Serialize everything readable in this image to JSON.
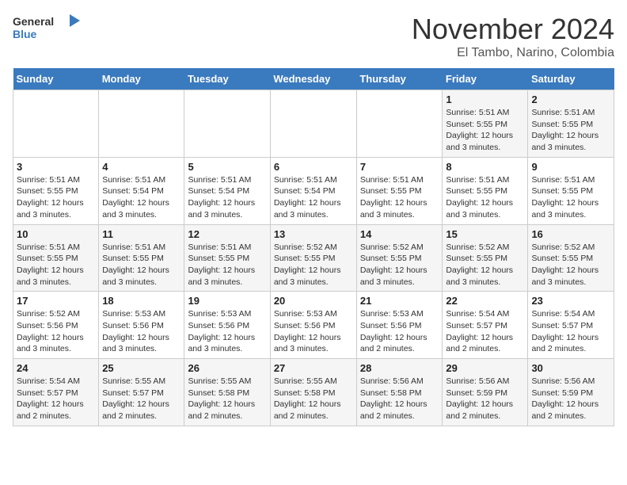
{
  "header": {
    "logo_general": "General",
    "logo_blue": "Blue",
    "month_title": "November 2024",
    "subtitle": "El Tambo, Narino, Colombia"
  },
  "days_of_week": [
    "Sunday",
    "Monday",
    "Tuesday",
    "Wednesday",
    "Thursday",
    "Friday",
    "Saturday"
  ],
  "weeks": [
    [
      {
        "day": "",
        "info": ""
      },
      {
        "day": "",
        "info": ""
      },
      {
        "day": "",
        "info": ""
      },
      {
        "day": "",
        "info": ""
      },
      {
        "day": "",
        "info": ""
      },
      {
        "day": "1",
        "info": "Sunrise: 5:51 AM\nSunset: 5:55 PM\nDaylight: 12 hours\nand 3 minutes."
      },
      {
        "day": "2",
        "info": "Sunrise: 5:51 AM\nSunset: 5:55 PM\nDaylight: 12 hours\nand 3 minutes."
      }
    ],
    [
      {
        "day": "3",
        "info": "Sunrise: 5:51 AM\nSunset: 5:55 PM\nDaylight: 12 hours\nand 3 minutes."
      },
      {
        "day": "4",
        "info": "Sunrise: 5:51 AM\nSunset: 5:54 PM\nDaylight: 12 hours\nand 3 minutes."
      },
      {
        "day": "5",
        "info": "Sunrise: 5:51 AM\nSunset: 5:54 PM\nDaylight: 12 hours\nand 3 minutes."
      },
      {
        "day": "6",
        "info": "Sunrise: 5:51 AM\nSunset: 5:54 PM\nDaylight: 12 hours\nand 3 minutes."
      },
      {
        "day": "7",
        "info": "Sunrise: 5:51 AM\nSunset: 5:55 PM\nDaylight: 12 hours\nand 3 minutes."
      },
      {
        "day": "8",
        "info": "Sunrise: 5:51 AM\nSunset: 5:55 PM\nDaylight: 12 hours\nand 3 minutes."
      },
      {
        "day": "9",
        "info": "Sunrise: 5:51 AM\nSunset: 5:55 PM\nDaylight: 12 hours\nand 3 minutes."
      }
    ],
    [
      {
        "day": "10",
        "info": "Sunrise: 5:51 AM\nSunset: 5:55 PM\nDaylight: 12 hours\nand 3 minutes."
      },
      {
        "day": "11",
        "info": "Sunrise: 5:51 AM\nSunset: 5:55 PM\nDaylight: 12 hours\nand 3 minutes."
      },
      {
        "day": "12",
        "info": "Sunrise: 5:51 AM\nSunset: 5:55 PM\nDaylight: 12 hours\nand 3 minutes."
      },
      {
        "day": "13",
        "info": "Sunrise: 5:52 AM\nSunset: 5:55 PM\nDaylight: 12 hours\nand 3 minutes."
      },
      {
        "day": "14",
        "info": "Sunrise: 5:52 AM\nSunset: 5:55 PM\nDaylight: 12 hours\nand 3 minutes."
      },
      {
        "day": "15",
        "info": "Sunrise: 5:52 AM\nSunset: 5:55 PM\nDaylight: 12 hours\nand 3 minutes."
      },
      {
        "day": "16",
        "info": "Sunrise: 5:52 AM\nSunset: 5:55 PM\nDaylight: 12 hours\nand 3 minutes."
      }
    ],
    [
      {
        "day": "17",
        "info": "Sunrise: 5:52 AM\nSunset: 5:56 PM\nDaylight: 12 hours\nand 3 minutes."
      },
      {
        "day": "18",
        "info": "Sunrise: 5:53 AM\nSunset: 5:56 PM\nDaylight: 12 hours\nand 3 minutes."
      },
      {
        "day": "19",
        "info": "Sunrise: 5:53 AM\nSunset: 5:56 PM\nDaylight: 12 hours\nand 3 minutes."
      },
      {
        "day": "20",
        "info": "Sunrise: 5:53 AM\nSunset: 5:56 PM\nDaylight: 12 hours\nand 3 minutes."
      },
      {
        "day": "21",
        "info": "Sunrise: 5:53 AM\nSunset: 5:56 PM\nDaylight: 12 hours\nand 2 minutes."
      },
      {
        "day": "22",
        "info": "Sunrise: 5:54 AM\nSunset: 5:57 PM\nDaylight: 12 hours\nand 2 minutes."
      },
      {
        "day": "23",
        "info": "Sunrise: 5:54 AM\nSunset: 5:57 PM\nDaylight: 12 hours\nand 2 minutes."
      }
    ],
    [
      {
        "day": "24",
        "info": "Sunrise: 5:54 AM\nSunset: 5:57 PM\nDaylight: 12 hours\nand 2 minutes."
      },
      {
        "day": "25",
        "info": "Sunrise: 5:55 AM\nSunset: 5:57 PM\nDaylight: 12 hours\nand 2 minutes."
      },
      {
        "day": "26",
        "info": "Sunrise: 5:55 AM\nSunset: 5:58 PM\nDaylight: 12 hours\nand 2 minutes."
      },
      {
        "day": "27",
        "info": "Sunrise: 5:55 AM\nSunset: 5:58 PM\nDaylight: 12 hours\nand 2 minutes."
      },
      {
        "day": "28",
        "info": "Sunrise: 5:56 AM\nSunset: 5:58 PM\nDaylight: 12 hours\nand 2 minutes."
      },
      {
        "day": "29",
        "info": "Sunrise: 5:56 AM\nSunset: 5:59 PM\nDaylight: 12 hours\nand 2 minutes."
      },
      {
        "day": "30",
        "info": "Sunrise: 5:56 AM\nSunset: 5:59 PM\nDaylight: 12 hours\nand 2 minutes."
      }
    ]
  ]
}
